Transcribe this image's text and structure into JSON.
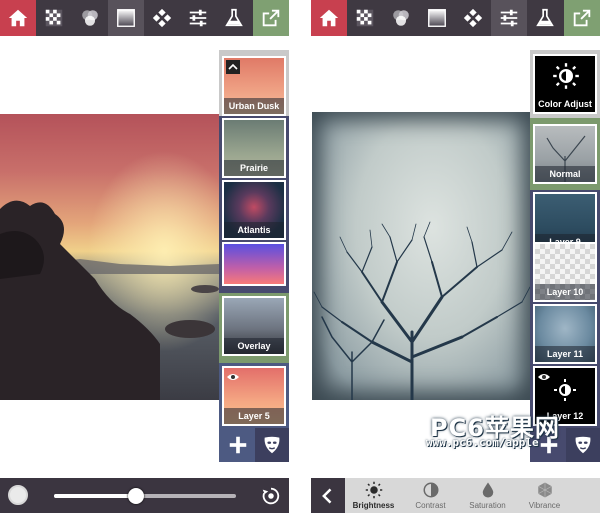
{
  "left_panel": {
    "layers": [
      {
        "label": "Urban Dusk",
        "bg": "#c9c9c9",
        "colors": [
          "#e98c6b",
          "#f4b08c"
        ]
      },
      {
        "label": "Prairie",
        "bg": "#474a6e",
        "colors": [
          "#5a6d6a",
          "#a4b09b"
        ]
      },
      {
        "label": "Atlantis",
        "bg": "#474a6e",
        "colors": [
          "#1b2f44",
          "#b1475e"
        ]
      },
      {
        "label": "",
        "bg": "#474a6e",
        "colors": [
          "#6a4fd6",
          "#f26a85"
        ]
      },
      {
        "label": "Overlay",
        "bg": "#7c9a6d",
        "colors": [
          "#8c9cab",
          "#3a3d44"
        ]
      },
      {
        "label": "Layer 5",
        "bg": "#4d5a82",
        "colors": [
          "#e97c6c",
          "#f5b38c"
        ]
      }
    ],
    "icons": {
      "toolbar": [
        "home-icon",
        "checkerboard-icon",
        "blend-circles-icon",
        "gradient-square-icon",
        "diamond-grid-icon",
        "sliders-icon",
        "flask-icon",
        "share-icon"
      ],
      "bottom": [
        "opacity-circle-icon",
        "reset-icon"
      ],
      "panel_buttons": [
        "plus-icon",
        "mask-icon"
      ]
    },
    "opacity_slider": 0.45
  },
  "right_panel": {
    "layers": [
      {
        "label": "Color Adjust",
        "bg": "#000000"
      },
      {
        "label": "Normal",
        "bg": "#7c9a6d"
      },
      {
        "label": "Layer 9",
        "bg": "#474a6e"
      },
      {
        "label": "Layer 10",
        "bg": "#474a6e"
      },
      {
        "label": "Layer 11",
        "bg": "#474a6e"
      },
      {
        "label": "Layer 12",
        "bg": "#474a6e"
      }
    ],
    "adjustments": [
      "Brightness",
      "Contrast",
      "Saturation",
      "Vibrance"
    ],
    "active_adjustment": "Brightness"
  },
  "watermark": {
    "title": "PC6苹果网",
    "url": "www.pc6.com/apple"
  },
  "colors": {
    "toolbar": "#3f3942",
    "home": "#c8404f",
    "share": "#7fa072",
    "layer_panel": "#474a6e",
    "bottom_left": "#3b3540",
    "bottom_right": "#d8d8d8"
  }
}
